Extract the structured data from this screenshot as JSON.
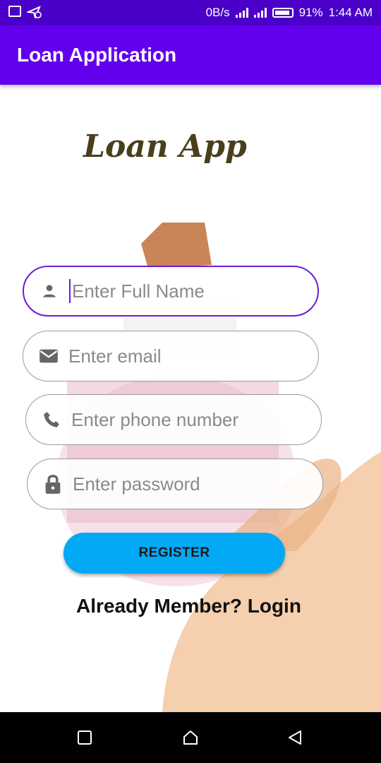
{
  "status_bar": {
    "data_rate": "0B/s",
    "battery_percent": "91%",
    "time": "1:44 AM",
    "icons": [
      "gallery-icon",
      "location-off-icon",
      "signal-icon",
      "battery-icon"
    ]
  },
  "app_bar": {
    "title": "Loan Application"
  },
  "logo": {
    "text": "Loan App"
  },
  "form": {
    "full_name": {
      "placeholder": "Enter Full Name",
      "value": "",
      "icon": "person-icon"
    },
    "email": {
      "placeholder": "Enter email",
      "value": "",
      "icon": "email-icon"
    },
    "phone": {
      "placeholder": "Enter phone number",
      "value": "",
      "icon": "phone-icon"
    },
    "password": {
      "placeholder": "Enter password",
      "value": "",
      "icon": "lock-icon"
    },
    "register_label": "REGISTER",
    "login_link": "Already Member? Login"
  },
  "colors": {
    "status_bar": "#4a00c8",
    "app_bar": "#6200ee",
    "accent": "#6a1bd6",
    "button": "#03a9f4"
  },
  "nav_bar": {
    "icons": [
      "recents-icon",
      "home-icon",
      "back-icon"
    ]
  }
}
